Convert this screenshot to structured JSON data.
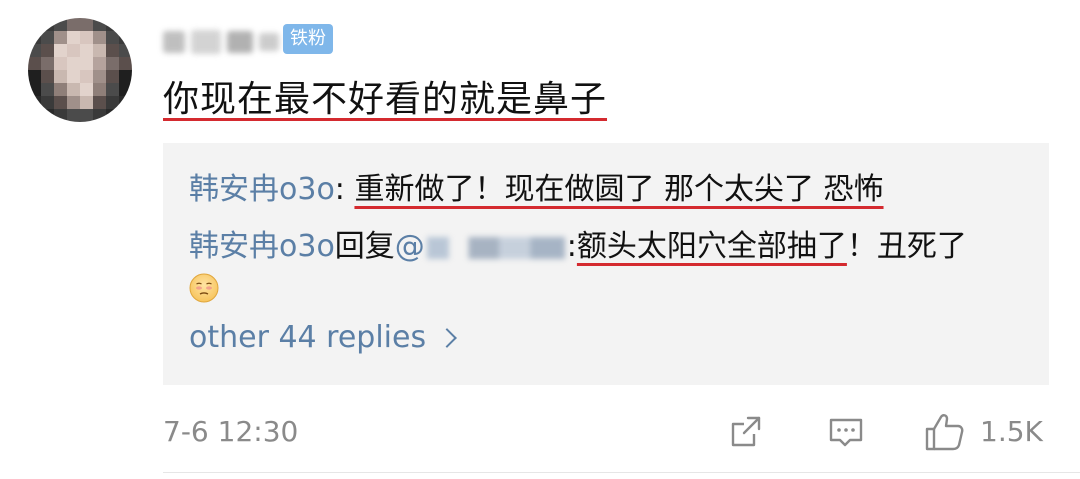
{
  "comment": {
    "badge": "铁粉",
    "text": "你现在最不好看的就是鼻子",
    "timestamp": "7-6 12:30",
    "like_count": "1.5K"
  },
  "replies": [
    {
      "author": "韩安冉o3o",
      "separator": ": ",
      "text": "重新做了！现在做圆了 那个太尖了 恐怖"
    },
    {
      "author": "韩安冉o3o",
      "reply_word": "回复",
      "at": "@",
      "mention_separator": ":",
      "text_underlined": "额头太阳穴全部抽了",
      "text_rest": "！丑死了"
    }
  ],
  "more_replies_label": "other 44 replies",
  "icons": {
    "share": "share-icon",
    "comment": "comment-icon",
    "like": "thumbs-up-icon",
    "chevron": "chevron-right-icon",
    "emoji": "pleading-face-emoji"
  },
  "colors": {
    "link": "#5b7fa6",
    "underline": "#d42a2f",
    "badge": "#7fb7ea",
    "reply_bg": "#f3f3f3",
    "meta": "#8a8a8a"
  }
}
